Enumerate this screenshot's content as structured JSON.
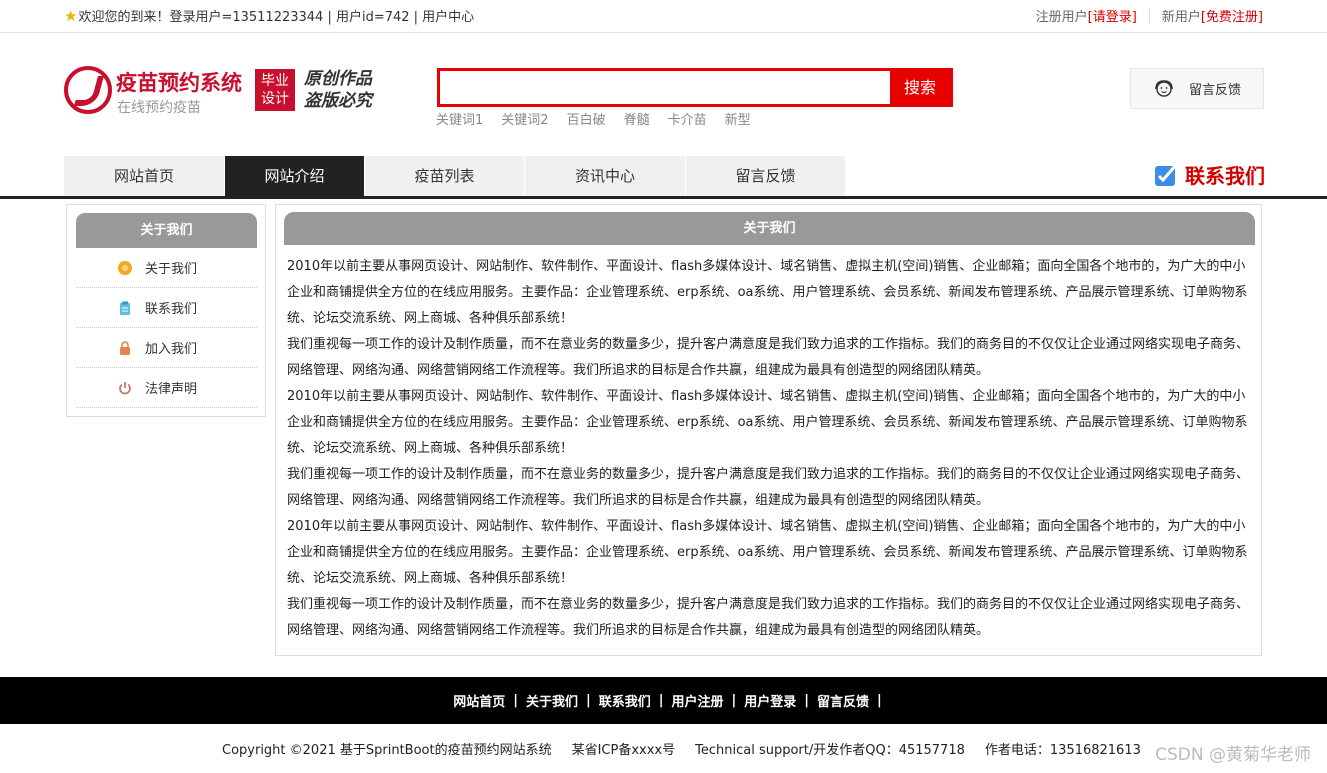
{
  "topbar": {
    "welcome": "欢迎您的到来！登录用户=13511223344 | 用户id=742 | 用户中心",
    "register_user": "注册用户",
    "login_link": "[请登录]",
    "new_user": "新用户",
    "free_register_link": "[免费注册]"
  },
  "header": {
    "logo_title": "疫苗预约系统",
    "logo_subtitle": "在线预约疫苗",
    "badge_line1": "毕业",
    "badge_line2": "设计",
    "slogan_line1": "原创作品",
    "slogan_line2": "盗版必究",
    "search_placeholder": "",
    "search_button": "搜索",
    "keywords": [
      "关键词1",
      "关键词2",
      "百白破",
      "脊髓",
      "卡介苗",
      "新型"
    ],
    "feedback_label": "留言反馈"
  },
  "nav": {
    "items": [
      {
        "label": "网站首页",
        "active": false
      },
      {
        "label": "网站介绍",
        "active": true
      },
      {
        "label": "疫苗列表",
        "active": false
      },
      {
        "label": "资讯中心",
        "active": false
      },
      {
        "label": "留言反馈",
        "active": false
      }
    ],
    "contact_us": "联系我们"
  },
  "sidebar": {
    "title": "关于我们",
    "items": [
      {
        "label": "关于我们",
        "icon": "info-circle-icon"
      },
      {
        "label": "联系我们",
        "icon": "clipboard-icon"
      },
      {
        "label": "加入我们",
        "icon": "lock-icon"
      },
      {
        "label": "法律声明",
        "icon": "power-icon"
      }
    ]
  },
  "main": {
    "title": "关于我们",
    "paragraphs": [
      "2010年以前主要从事网页设计、网站制作、软件制作、平面设计、flash多媒体设计、域名销售、虚拟主机(空间)销售、企业邮箱；面向全国各个地市的，为广大的中小企业和商铺提供全方位的在线应用服务。主要作品：企业管理系统、erp系统、oa系统、用户管理系统、会员系统、新闻发布管理系统、产品展示管理系统、订单购物系统、论坛交流系统、网上商城、各种俱乐部系统！",
      "我们重视每一项工作的设计及制作质量，而不在意业务的数量多少，提升客户满意度是我们致力追求的工作指标。我们的商务目的不仅仅让企业通过网络实现电子商务、网络管理、网络沟通、网络营销网络工作流程等。我们所追求的目标是合作共赢，组建成为最具有创造型的网络团队精英。",
      "2010年以前主要从事网页设计、网站制作、软件制作、平面设计、flash多媒体设计、域名销售、虚拟主机(空间)销售、企业邮箱；面向全国各个地市的，为广大的中小企业和商铺提供全方位的在线应用服务。主要作品：企业管理系统、erp系统、oa系统、用户管理系统、会员系统、新闻发布管理系统、产品展示管理系统、订单购物系统、论坛交流系统、网上商城、各种俱乐部系统！",
      "我们重视每一项工作的设计及制作质量，而不在意业务的数量多少，提升客户满意度是我们致力追求的工作指标。我们的商务目的不仅仅让企业通过网络实现电子商务、网络管理、网络沟通、网络营销网络工作流程等。我们所追求的目标是合作共赢，组建成为最具有创造型的网络团队精英。",
      "2010年以前主要从事网页设计、网站制作、软件制作、平面设计、flash多媒体设计、域名销售、虚拟主机(空间)销售、企业邮箱；面向全国各个地市的，为广大的中小企业和商铺提供全方位的在线应用服务。主要作品：企业管理系统、erp系统、oa系统、用户管理系统、会员系统、新闻发布管理系统、产品展示管理系统、订单购物系统、论坛交流系统、网上商城、各种俱乐部系统！",
      "我们重视每一项工作的设计及制作质量，而不在意业务的数量多少，提升客户满意度是我们致力追求的工作指标。我们的商务目的不仅仅让企业通过网络实现电子商务、网络管理、网络沟通、网络营销网络工作流程等。我们所追求的目标是合作共赢，组建成为最具有创造型的网络团队精英。"
    ]
  },
  "footer": {
    "links": [
      "网站首页",
      "关于我们",
      "联系我们",
      "用户注册",
      "用户登录",
      "留言反馈"
    ],
    "separator": "|",
    "copyright": "Copyright ©2021 基于SprintBoot的疫苗预约网站系统",
    "icp": "某省ICP备xxxx号",
    "support": "Technical support/开发作者QQ：45157718",
    "phone": "作者电话：13516821613",
    "watermark": "CSDN @黄菊华老师"
  },
  "colors": {
    "brand_red": "#c8102e",
    "search_red": "#e80000",
    "nav_active": "#222222",
    "panel_header": "#999999"
  }
}
